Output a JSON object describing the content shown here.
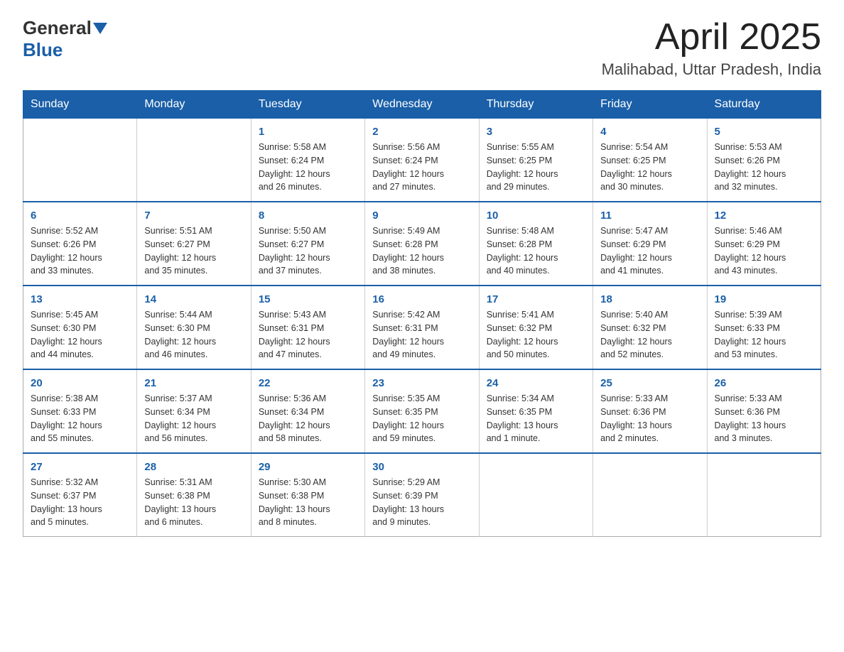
{
  "logo": {
    "general": "General",
    "blue": "Blue"
  },
  "title": "April 2025",
  "subtitle": "Malihabad, Uttar Pradesh, India",
  "days_of_week": [
    "Sunday",
    "Monday",
    "Tuesday",
    "Wednesday",
    "Thursday",
    "Friday",
    "Saturday"
  ],
  "weeks": [
    [
      {
        "day": "",
        "info": ""
      },
      {
        "day": "",
        "info": ""
      },
      {
        "day": "1",
        "info": "Sunrise: 5:58 AM\nSunset: 6:24 PM\nDaylight: 12 hours\nand 26 minutes."
      },
      {
        "day": "2",
        "info": "Sunrise: 5:56 AM\nSunset: 6:24 PM\nDaylight: 12 hours\nand 27 minutes."
      },
      {
        "day": "3",
        "info": "Sunrise: 5:55 AM\nSunset: 6:25 PM\nDaylight: 12 hours\nand 29 minutes."
      },
      {
        "day": "4",
        "info": "Sunrise: 5:54 AM\nSunset: 6:25 PM\nDaylight: 12 hours\nand 30 minutes."
      },
      {
        "day": "5",
        "info": "Sunrise: 5:53 AM\nSunset: 6:26 PM\nDaylight: 12 hours\nand 32 minutes."
      }
    ],
    [
      {
        "day": "6",
        "info": "Sunrise: 5:52 AM\nSunset: 6:26 PM\nDaylight: 12 hours\nand 33 minutes."
      },
      {
        "day": "7",
        "info": "Sunrise: 5:51 AM\nSunset: 6:27 PM\nDaylight: 12 hours\nand 35 minutes."
      },
      {
        "day": "8",
        "info": "Sunrise: 5:50 AM\nSunset: 6:27 PM\nDaylight: 12 hours\nand 37 minutes."
      },
      {
        "day": "9",
        "info": "Sunrise: 5:49 AM\nSunset: 6:28 PM\nDaylight: 12 hours\nand 38 minutes."
      },
      {
        "day": "10",
        "info": "Sunrise: 5:48 AM\nSunset: 6:28 PM\nDaylight: 12 hours\nand 40 minutes."
      },
      {
        "day": "11",
        "info": "Sunrise: 5:47 AM\nSunset: 6:29 PM\nDaylight: 12 hours\nand 41 minutes."
      },
      {
        "day": "12",
        "info": "Sunrise: 5:46 AM\nSunset: 6:29 PM\nDaylight: 12 hours\nand 43 minutes."
      }
    ],
    [
      {
        "day": "13",
        "info": "Sunrise: 5:45 AM\nSunset: 6:30 PM\nDaylight: 12 hours\nand 44 minutes."
      },
      {
        "day": "14",
        "info": "Sunrise: 5:44 AM\nSunset: 6:30 PM\nDaylight: 12 hours\nand 46 minutes."
      },
      {
        "day": "15",
        "info": "Sunrise: 5:43 AM\nSunset: 6:31 PM\nDaylight: 12 hours\nand 47 minutes."
      },
      {
        "day": "16",
        "info": "Sunrise: 5:42 AM\nSunset: 6:31 PM\nDaylight: 12 hours\nand 49 minutes."
      },
      {
        "day": "17",
        "info": "Sunrise: 5:41 AM\nSunset: 6:32 PM\nDaylight: 12 hours\nand 50 minutes."
      },
      {
        "day": "18",
        "info": "Sunrise: 5:40 AM\nSunset: 6:32 PM\nDaylight: 12 hours\nand 52 minutes."
      },
      {
        "day": "19",
        "info": "Sunrise: 5:39 AM\nSunset: 6:33 PM\nDaylight: 12 hours\nand 53 minutes."
      }
    ],
    [
      {
        "day": "20",
        "info": "Sunrise: 5:38 AM\nSunset: 6:33 PM\nDaylight: 12 hours\nand 55 minutes."
      },
      {
        "day": "21",
        "info": "Sunrise: 5:37 AM\nSunset: 6:34 PM\nDaylight: 12 hours\nand 56 minutes."
      },
      {
        "day": "22",
        "info": "Sunrise: 5:36 AM\nSunset: 6:34 PM\nDaylight: 12 hours\nand 58 minutes."
      },
      {
        "day": "23",
        "info": "Sunrise: 5:35 AM\nSunset: 6:35 PM\nDaylight: 12 hours\nand 59 minutes."
      },
      {
        "day": "24",
        "info": "Sunrise: 5:34 AM\nSunset: 6:35 PM\nDaylight: 13 hours\nand 1 minute."
      },
      {
        "day": "25",
        "info": "Sunrise: 5:33 AM\nSunset: 6:36 PM\nDaylight: 13 hours\nand 2 minutes."
      },
      {
        "day": "26",
        "info": "Sunrise: 5:33 AM\nSunset: 6:36 PM\nDaylight: 13 hours\nand 3 minutes."
      }
    ],
    [
      {
        "day": "27",
        "info": "Sunrise: 5:32 AM\nSunset: 6:37 PM\nDaylight: 13 hours\nand 5 minutes."
      },
      {
        "day": "28",
        "info": "Sunrise: 5:31 AM\nSunset: 6:38 PM\nDaylight: 13 hours\nand 6 minutes."
      },
      {
        "day": "29",
        "info": "Sunrise: 5:30 AM\nSunset: 6:38 PM\nDaylight: 13 hours\nand 8 minutes."
      },
      {
        "day": "30",
        "info": "Sunrise: 5:29 AM\nSunset: 6:39 PM\nDaylight: 13 hours\nand 9 minutes."
      },
      {
        "day": "",
        "info": ""
      },
      {
        "day": "",
        "info": ""
      },
      {
        "day": "",
        "info": ""
      }
    ]
  ]
}
